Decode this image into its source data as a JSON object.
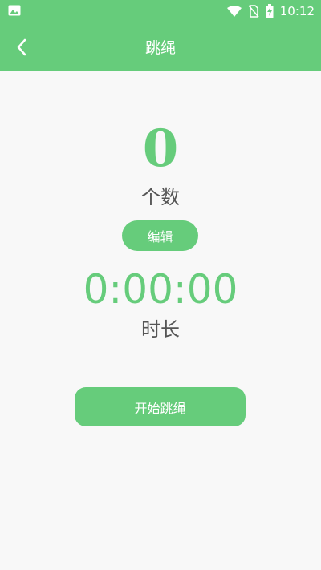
{
  "colors": {
    "primary": "#66cc7b",
    "background": "#f8f8f8",
    "text_secondary": "#555555"
  },
  "statusbar": {
    "time": "10:12",
    "icons": [
      "image-notification-icon",
      "wifi-icon",
      "no-sim-icon",
      "battery-charging-icon"
    ]
  },
  "appbar": {
    "title": "跳绳",
    "back_icon": "chevron-left-icon"
  },
  "count": {
    "value": "0",
    "label": "个数"
  },
  "edit_button": {
    "label": "编辑"
  },
  "duration": {
    "value": "0:00:00",
    "label": "时长"
  },
  "start_button": {
    "label": "开始跳绳"
  }
}
